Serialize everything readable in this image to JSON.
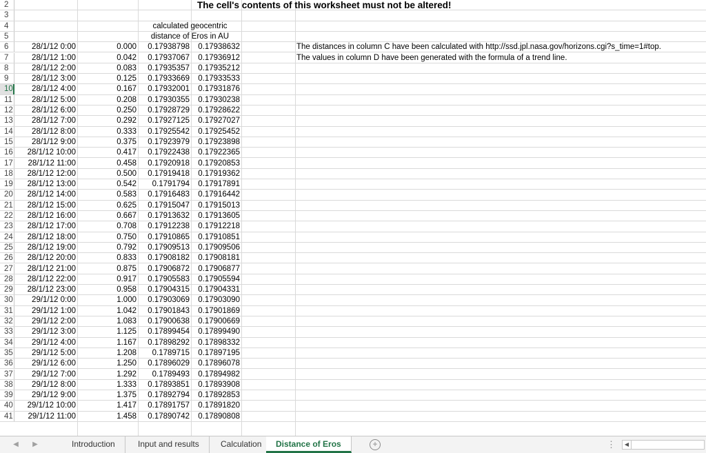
{
  "title": "The cell's contents of this worksheet must not be altered!",
  "header": {
    "line1": "calculated geocentric",
    "line2": "distance of Eros in AU"
  },
  "notes": [
    "The distances in column C have been calculated with http://ssd.jpl.nasa.gov/horizons.cgi?s_time=1#top.",
    "The values in column D have been generated with the formula of a trend line."
  ],
  "row_numbers": [
    "2",
    "3",
    "4",
    "5",
    "6",
    "7",
    "8",
    "9",
    "10",
    "11",
    "12",
    "13",
    "14",
    "15",
    "16",
    "17",
    "18",
    "19",
    "20",
    "21",
    "22",
    "23",
    "24",
    "25",
    "26",
    "27",
    "28",
    "29",
    "30",
    "31",
    "32",
    "33",
    "34",
    "35",
    "36",
    "37",
    "38",
    "39",
    "40",
    "41"
  ],
  "active_row": "10",
  "rows": [
    {
      "a": "28/1/12 0:00",
      "b": "0.000",
      "c": "0.17938798",
      "d": "0.17938632"
    },
    {
      "a": "28/1/12 1:00",
      "b": "0.042",
      "c": "0.17937067",
      "d": "0.17936912"
    },
    {
      "a": "28/1/12 2:00",
      "b": "0.083",
      "c": "0.17935357",
      "d": "0.17935212"
    },
    {
      "a": "28/1/12 3:00",
      "b": "0.125",
      "c": "0.17933669",
      "d": "0.17933533"
    },
    {
      "a": "28/1/12 4:00",
      "b": "0.167",
      "c": "0.17932001",
      "d": "0.17931876"
    },
    {
      "a": "28/1/12 5:00",
      "b": "0.208",
      "c": "0.17930355",
      "d": "0.17930238"
    },
    {
      "a": "28/1/12 6:00",
      "b": "0.250",
      "c": "0.17928729",
      "d": "0.17928622"
    },
    {
      "a": "28/1/12 7:00",
      "b": "0.292",
      "c": "0.17927125",
      "d": "0.17927027"
    },
    {
      "a": "28/1/12 8:00",
      "b": "0.333",
      "c": "0.17925542",
      "d": "0.17925452"
    },
    {
      "a": "28/1/12 9:00",
      "b": "0.375",
      "c": "0.17923979",
      "d": "0.17923898"
    },
    {
      "a": "28/1/12 10:00",
      "b": "0.417",
      "c": "0.17922438",
      "d": "0.17922365"
    },
    {
      "a": "28/1/12 11:00",
      "b": "0.458",
      "c": "0.17920918",
      "d": "0.17920853"
    },
    {
      "a": "28/1/12 12:00",
      "b": "0.500",
      "c": "0.17919418",
      "d": "0.17919362"
    },
    {
      "a": "28/1/12 13:00",
      "b": "0.542",
      "c": "0.1791794",
      "d": "0.17917891"
    },
    {
      "a": "28/1/12 14:00",
      "b": "0.583",
      "c": "0.17916483",
      "d": "0.17916442"
    },
    {
      "a": "28/1/12 15:00",
      "b": "0.625",
      "c": "0.17915047",
      "d": "0.17915013"
    },
    {
      "a": "28/1/12 16:00",
      "b": "0.667",
      "c": "0.17913632",
      "d": "0.17913605"
    },
    {
      "a": "28/1/12 17:00",
      "b": "0.708",
      "c": "0.17912238",
      "d": "0.17912218"
    },
    {
      "a": "28/1/12 18:00",
      "b": "0.750",
      "c": "0.17910865",
      "d": "0.17910851"
    },
    {
      "a": "28/1/12 19:00",
      "b": "0.792",
      "c": "0.17909513",
      "d": "0.17909506"
    },
    {
      "a": "28/1/12 20:00",
      "b": "0.833",
      "c": "0.17908182",
      "d": "0.17908181"
    },
    {
      "a": "28/1/12 21:00",
      "b": "0.875",
      "c": "0.17906872",
      "d": "0.17906877"
    },
    {
      "a": "28/1/12 22:00",
      "b": "0.917",
      "c": "0.17905583",
      "d": "0.17905594"
    },
    {
      "a": "28/1/12 23:00",
      "b": "0.958",
      "c": "0.17904315",
      "d": "0.17904331"
    },
    {
      "a": "29/1/12 0:00",
      "b": "1.000",
      "c": "0.17903069",
      "d": "0.17903090"
    },
    {
      "a": "29/1/12 1:00",
      "b": "1.042",
      "c": "0.17901843",
      "d": "0.17901869"
    },
    {
      "a": "29/1/12 2:00",
      "b": "1.083",
      "c": "0.17900638",
      "d": "0.17900669"
    },
    {
      "a": "29/1/12 3:00",
      "b": "1.125",
      "c": "0.17899454",
      "d": "0.17899490"
    },
    {
      "a": "29/1/12 4:00",
      "b": "1.167",
      "c": "0.17898292",
      "d": "0.17898332"
    },
    {
      "a": "29/1/12 5:00",
      "b": "1.208",
      "c": "0.1789715",
      "d": "0.17897195"
    },
    {
      "a": "29/1/12 6:00",
      "b": "1.250",
      "c": "0.17896029",
      "d": "0.17896078"
    },
    {
      "a": "29/1/12 7:00",
      "b": "1.292",
      "c": "0.1789493",
      "d": "0.17894982"
    },
    {
      "a": "29/1/12 8:00",
      "b": "1.333",
      "c": "0.17893851",
      "d": "0.17893908"
    },
    {
      "a": "29/1/12 9:00",
      "b": "1.375",
      "c": "0.17892794",
      "d": "0.17892853"
    },
    {
      "a": "29/1/12 10:00",
      "b": "1.417",
      "c": "0.17891757",
      "d": "0.17891820"
    },
    {
      "a": "29/1/12 11:00",
      "b": "1.458",
      "c": "0.17890742",
      "d": "0.17890808"
    }
  ],
  "tabs": [
    {
      "label": "Introduction",
      "active": false
    },
    {
      "label": "Input and results",
      "active": false
    },
    {
      "label": "Calculation",
      "active": false
    },
    {
      "label": "Distance of Eros",
      "active": true
    }
  ],
  "icons": {
    "prev_sheet": "◀",
    "next_sheet": "▶",
    "add_sheet": "+",
    "more": "⋮",
    "scroll_left": "◀"
  },
  "colors": {
    "accent": "#217346"
  }
}
